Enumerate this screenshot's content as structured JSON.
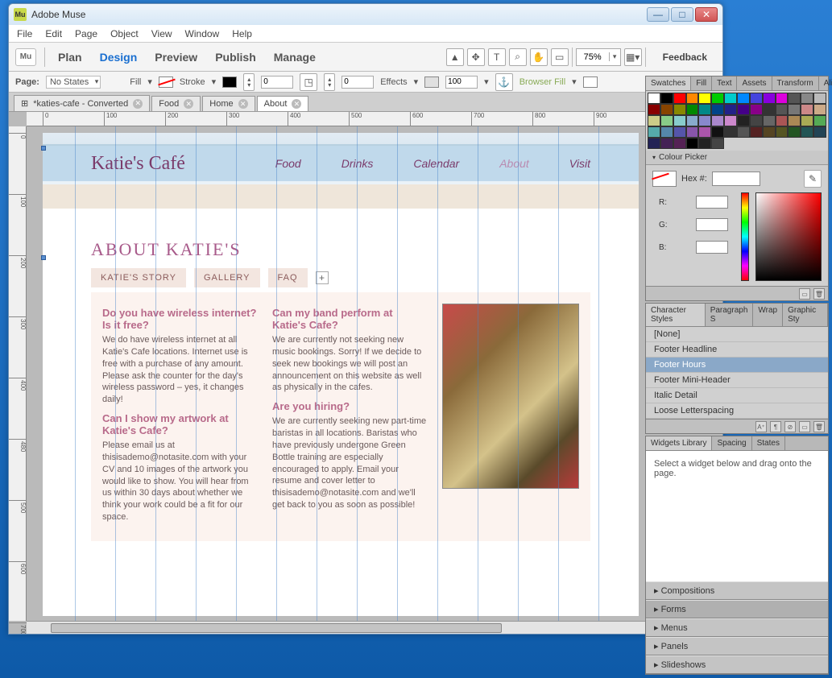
{
  "window": {
    "title": "Adobe Muse",
    "logo": "Mu"
  },
  "menu": [
    "File",
    "Edit",
    "Page",
    "Object",
    "View",
    "Window",
    "Help"
  ],
  "modes": {
    "logo": "Mu",
    "items": [
      "Plan",
      "Design",
      "Preview",
      "Publish",
      "Manage"
    ],
    "active": "Design",
    "feedback": "Feedback"
  },
  "zoom": "75%",
  "optbar": {
    "page_label": "Page:",
    "page_state": "No States",
    "fill_label": "Fill",
    "stroke_label": "Stroke",
    "stroke_val": "0",
    "corner_val": "0",
    "effects_label": "Effects",
    "opacity": "100",
    "browserfill": "Browser Fill"
  },
  "doctabs": [
    {
      "label": "*katies-cafe - Converted",
      "active": false,
      "icon": true
    },
    {
      "label": "Food",
      "active": false
    },
    {
      "label": "Home",
      "active": false
    },
    {
      "label": "About",
      "active": true
    }
  ],
  "ruler_h": [
    "0",
    "100",
    "200",
    "300",
    "400",
    "500",
    "600",
    "700",
    "800",
    "900"
  ],
  "ruler_v": [
    "0",
    "100",
    "200",
    "300",
    "400",
    "480",
    "500",
    "600",
    "700"
  ],
  "site": {
    "brand": "Katie's Café",
    "nav": [
      "Food",
      "Drinks",
      "Calendar",
      "About",
      "Visit"
    ],
    "nav_active": "About",
    "heading": "ABOUT KATIE'S",
    "tabs": [
      "KATIE'S STORY",
      "GALLERY",
      "FAQ"
    ],
    "col1": [
      {
        "h": "Do you have wireless internet? Is it free?",
        "p": "We do have wireless internet at all Katie's Cafe locations. Internet use is free with a purchase of any amount. Please ask the counter for the day's wireless password – yes, it changes daily!"
      },
      {
        "h": "Can I show my artwork at Katie's Cafe?",
        "p": "Please email us at thisisademo@notasite.com with your CV and 10 images of the artwork you would like to show. You will hear from us within 30 days about whether we think your work could be a fit for our space."
      }
    ],
    "col2": [
      {
        "h": "Can my band perform at Katie's Cafe?",
        "p": "We are currently not seeking new music bookings. Sorry! If we decide to seek new bookings we will post an announcement on this website as well as physically in the cafes."
      },
      {
        "h": "Are you hiring?",
        "p": "We are currently seeking new part-time baristas in all locations. Baristas who have previously undergone Green Bottle training are especially encouraged to apply. Email your resume and cover letter to thisisademo@notasite.com and we'll get back to you as soon as possible!"
      }
    ]
  },
  "panel_swatches": {
    "tabs": [
      "Swatches",
      "Fill",
      "Text",
      "Assets",
      "Transform",
      "Align"
    ],
    "active": "Swatches"
  },
  "swatch_colors": [
    "#fff",
    "#000",
    "#f00",
    "#f80",
    "#ff0",
    "#0c0",
    "#0cc",
    "#08f",
    "#44d",
    "#80d",
    "#d0d",
    "#555",
    "#888",
    "#bbb",
    "#800",
    "#840",
    "#880",
    "#080",
    "#088",
    "#048",
    "#228",
    "#408",
    "#808",
    "#333",
    "#555",
    "#777",
    "#c88",
    "#ca8",
    "#cc8",
    "#8c8",
    "#8cc",
    "#8ac",
    "#88c",
    "#a8c",
    "#c8c",
    "#222",
    "#444",
    "#666",
    "#a55",
    "#a85",
    "#aa5",
    "#5a5",
    "#5aa",
    "#58a",
    "#55a",
    "#85a",
    "#a5a",
    "#111",
    "#333",
    "#555",
    "#522",
    "#542",
    "#552",
    "#252",
    "#255",
    "#245",
    "#225",
    "#425",
    "#525",
    "#000",
    "#222",
    "#444"
  ],
  "colorpicker": {
    "title": "Colour Picker",
    "hex_label": "Hex #:",
    "r": "R:",
    "g": "G:",
    "b": "B:",
    "hex": "",
    "rv": "",
    "gv": "",
    "bv": ""
  },
  "panel_styles": {
    "tabs": [
      "Character Styles",
      "Paragraph S",
      "Wrap",
      "Graphic Sty"
    ],
    "active": "Character Styles",
    "items": [
      "[None]",
      "Footer Headline",
      "Footer Hours",
      "Footer Mini-Header",
      "Italic Detail",
      "Loose Letterspacing"
    ],
    "selected": "Footer Hours"
  },
  "panel_widgets": {
    "tabs": [
      "Widgets Library",
      "Spacing",
      "States"
    ],
    "active": "Widgets Library",
    "hint": "Select a widget below and drag onto the page.",
    "cats": [
      "Compositions",
      "Forms",
      "Menus",
      "Panels",
      "Slideshows"
    ],
    "selected": "Forms"
  }
}
